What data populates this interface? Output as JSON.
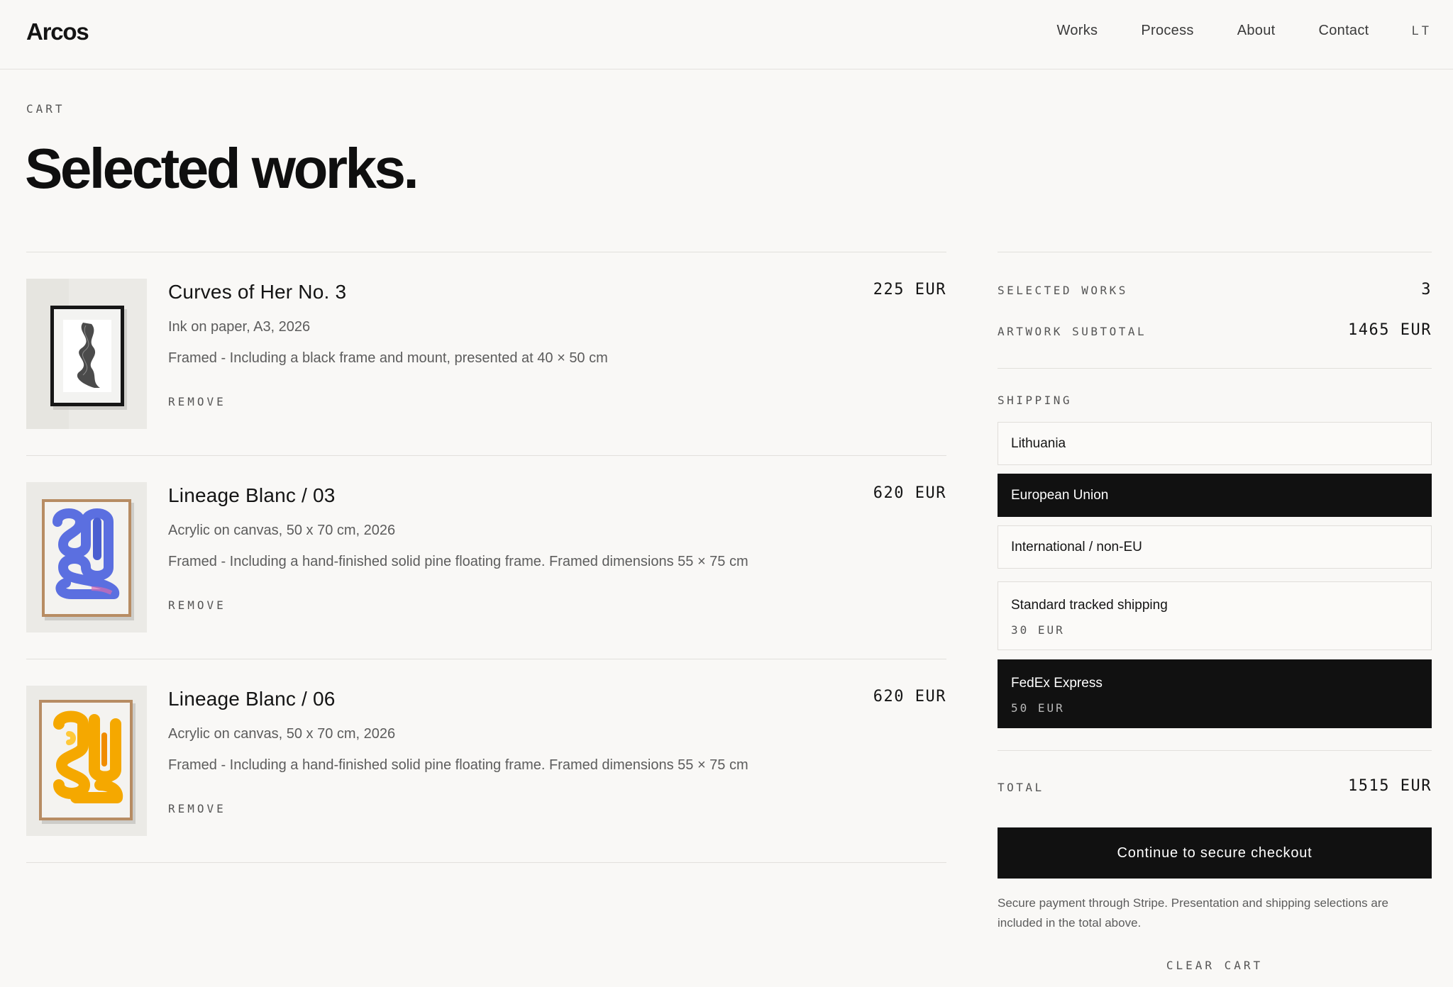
{
  "header": {
    "logo": "Arcos",
    "nav": [
      "Works",
      "Process",
      "About",
      "Contact"
    ],
    "lang": "LT"
  },
  "page": {
    "eyebrow": "CART",
    "title": "Selected works."
  },
  "cart": {
    "items": [
      {
        "title": "Curves of Her No. 3",
        "medium": "Ink on paper, A3, 2026",
        "frame": "Framed - Including a black frame and mount, presented at 40 × 50 cm",
        "remove": "REMOVE",
        "price": "225 EUR",
        "thumb_color": "#1a1a1a"
      },
      {
        "title": "Lineage Blanc / 03",
        "medium": "Acrylic on canvas, 50 x 70 cm, 2026",
        "frame": "Framed - Including a hand-finished solid pine floating frame. Framed dimensions 55 × 75 cm",
        "remove": "REMOVE",
        "price": "620 EUR",
        "thumb_color": "#5b6fe0"
      },
      {
        "title": "Lineage Blanc / 06",
        "medium": "Acrylic on canvas, 50 x 70 cm, 2026",
        "frame": "Framed - Including a hand-finished solid pine floating frame. Framed dimensions 55 × 75 cm",
        "remove": "REMOVE",
        "price": "620 EUR",
        "thumb_color": "#f5a800"
      }
    ]
  },
  "summary": {
    "selected_label": "SELECTED WORKS",
    "selected_value": "3",
    "subtotal_label": "ARTWORK SUBTOTAL",
    "subtotal_value": "1465 EUR",
    "shipping_label": "SHIPPING",
    "regions": [
      {
        "label": "Lithuania",
        "selected": false
      },
      {
        "label": "European Union",
        "selected": true
      },
      {
        "label": "International / non-EU",
        "selected": false
      }
    ],
    "methods": [
      {
        "name": "Standard tracked shipping",
        "price": "30 EUR",
        "selected": false
      },
      {
        "name": "FedEx Express",
        "price": "50 EUR",
        "selected": true
      }
    ],
    "total_label": "TOTAL",
    "total_value": "1515 EUR",
    "checkout_label": "Continue to secure checkout",
    "note": "Secure payment through Stripe. Presentation and shipping selections are included in the total above.",
    "clear_label": "CLEAR CART"
  },
  "colors": {
    "background": "#f9f8f6",
    "text": "#141414",
    "muted": "#5c5c5c",
    "active": "#111111"
  }
}
